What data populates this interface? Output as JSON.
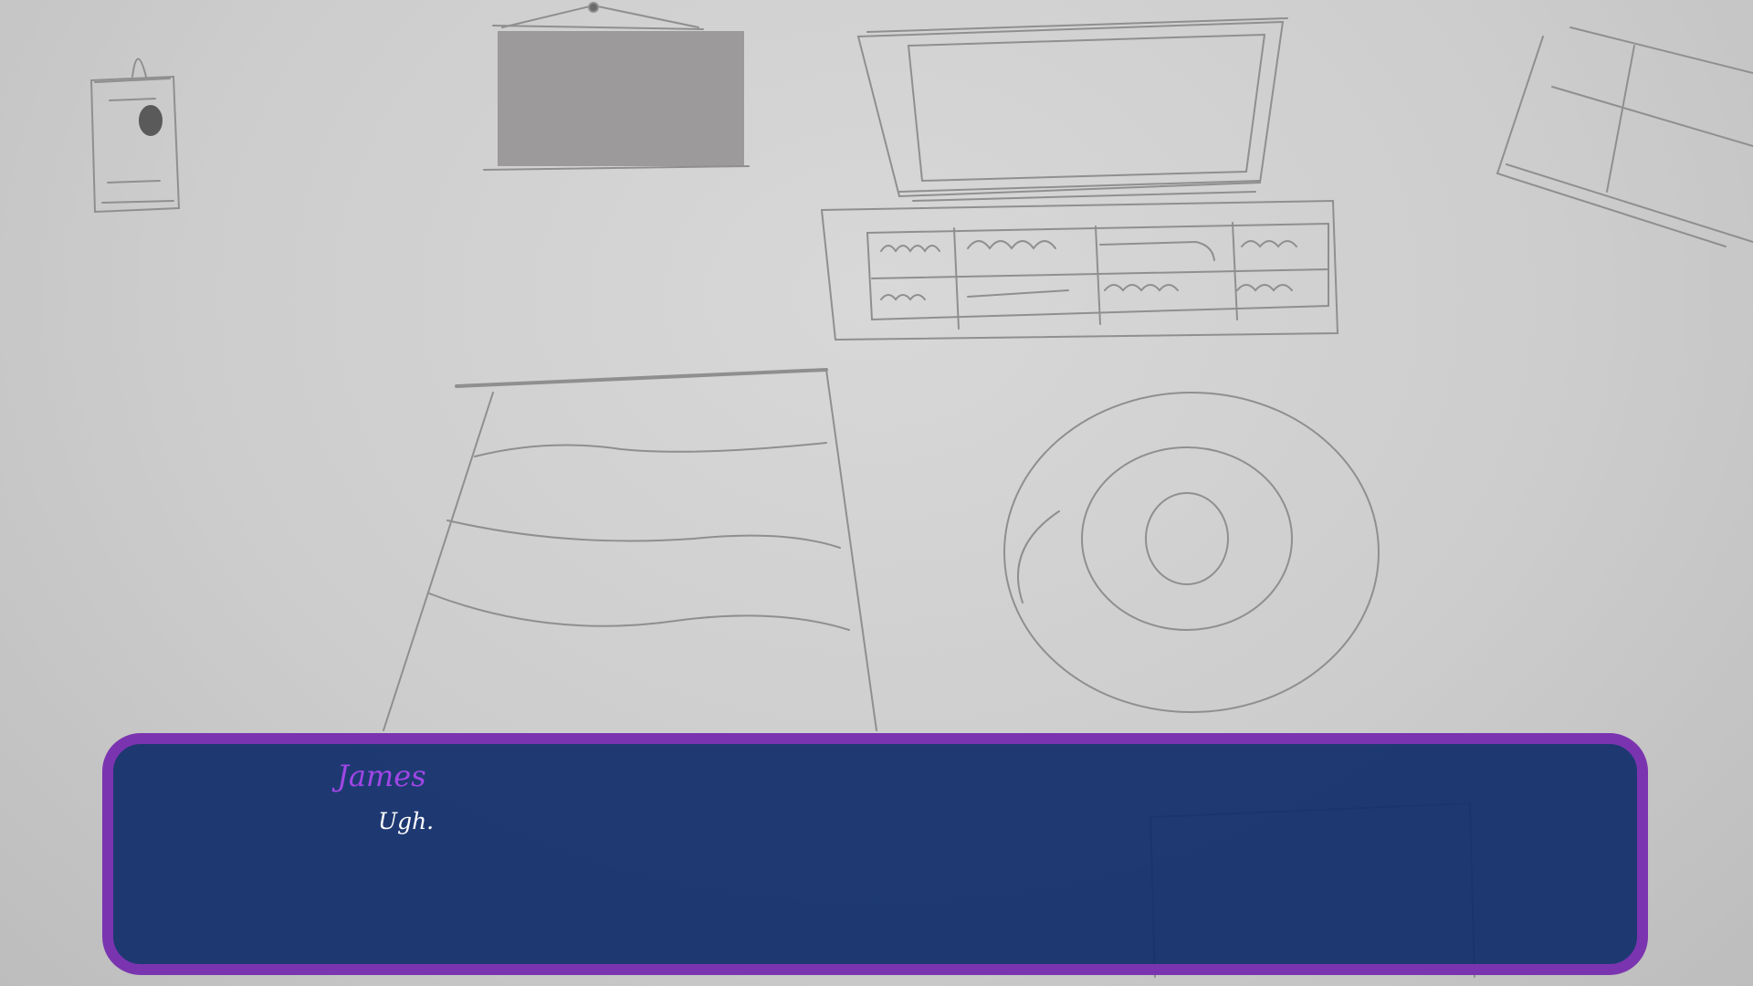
{
  "dialogue": {
    "speaker": "James",
    "text": "Ugh."
  },
  "colors": {
    "box_fill": "#112e6c",
    "box_border": "#7b34b0",
    "speaker_color": "#a046e6",
    "text_color": "#ffffff"
  },
  "background": {
    "description_icons": [
      "poster-icon",
      "framed-picture-icon",
      "tv-icon",
      "tv-stand-icon",
      "window-icon",
      "bed-icon",
      "rug-icon"
    ]
  }
}
